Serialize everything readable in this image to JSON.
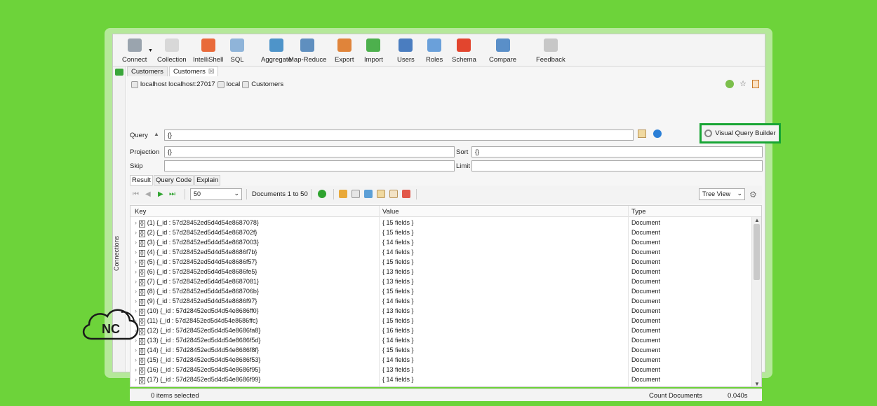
{
  "toolbar": [
    {
      "label": "Connect",
      "icon": "connect-icon",
      "color": "#9aa4ae"
    },
    {
      "label": "Collection",
      "icon": "collection-icon",
      "color": "#d8d8d8"
    },
    {
      "label": "IntelliShell",
      "icon": "intellishell-icon",
      "color": "#e96a3a"
    },
    {
      "label": "SQL",
      "icon": "sql-icon",
      "color": "#8fb4d9"
    },
    {
      "label": "Aggregate",
      "icon": "aggregate-icon",
      "color": "#4e94c9"
    },
    {
      "label": "Map-Reduce",
      "icon": "map-reduce-icon",
      "color": "#5f8fbf"
    },
    {
      "label": "Export",
      "icon": "export-icon",
      "color": "#e0843a"
    },
    {
      "label": "Import",
      "icon": "import-icon",
      "color": "#4db04d"
    },
    {
      "label": "Users",
      "icon": "users-icon",
      "color": "#4a7dc0"
    },
    {
      "label": "Roles",
      "icon": "roles-icon",
      "color": "#6aa0da"
    },
    {
      "label": "Schema",
      "icon": "schema-icon",
      "color": "#e2452e"
    },
    {
      "label": "Compare",
      "icon": "compare-icon",
      "color": "#5a8fc8"
    },
    {
      "label": "Feedback",
      "icon": "feedback-icon",
      "color": "#c7c7c7"
    }
  ],
  "sidebar": {
    "label": "Connections"
  },
  "tabs": [
    {
      "label": "Customers"
    },
    {
      "label": "Customers",
      "close": "☒"
    }
  ],
  "breadcrumb": {
    "server": "localhost localhost:27017",
    "db": "local",
    "collection": "Customers"
  },
  "query": {
    "query_label": "Query",
    "query_value": "{}",
    "projection_label": "Projection",
    "projection_value": "{}",
    "sort_label": "Sort",
    "sort_value": "{}",
    "skip_label": "Skip",
    "skip_value": "",
    "limit_label": "Limit",
    "limit_value": "",
    "vqb_label": "Visual Query Builder"
  },
  "result_tabs": [
    {
      "label": "Result"
    },
    {
      "label": "Query Code"
    },
    {
      "label": "Explain"
    }
  ],
  "pager": {
    "page_size": "50",
    "docs_label": "Documents 1 to 50",
    "view": "Tree View"
  },
  "grid": {
    "columns": [
      "Key",
      "Value",
      "Type"
    ],
    "rows": [
      {
        "key": "(1) {_id : 57d28452ed5d4d54e8687078}",
        "value": "{ 15 fields }",
        "type": "Document"
      },
      {
        "key": "(2) {_id : 57d28452ed5d4d54e868702f}",
        "value": "{ 15 fields }",
        "type": "Document"
      },
      {
        "key": "(3) {_id : 57d28452ed5d4d54e8687003}",
        "value": "{ 14 fields }",
        "type": "Document"
      },
      {
        "key": "(4) {_id : 57d28452ed5d4d54e8686f7b}",
        "value": "{ 14 fields }",
        "type": "Document"
      },
      {
        "key": "(5) {_id : 57d28452ed5d4d54e8686f57}",
        "value": "{ 15 fields }",
        "type": "Document"
      },
      {
        "key": "(6) {_id : 57d28452ed5d4d54e8686fe5}",
        "value": "{ 13 fields }",
        "type": "Document"
      },
      {
        "key": "(7) {_id : 57d28452ed5d4d54e8687081}",
        "value": "{ 13 fields }",
        "type": "Document"
      },
      {
        "key": "(8) {_id : 57d28452ed5d4d54e868706b}",
        "value": "{ 15 fields }",
        "type": "Document"
      },
      {
        "key": "(9) {_id : 57d28452ed5d4d54e8686f97}",
        "value": "{ 14 fields }",
        "type": "Document"
      },
      {
        "key": "(10) {_id : 57d28452ed5d4d54e8686ff0}",
        "value": "{ 13 fields }",
        "type": "Document"
      },
      {
        "key": "(11) {_id : 57d28452ed5d4d54e8686ffc}",
        "value": "{ 15 fields }",
        "type": "Document"
      },
      {
        "key": "(12) {_id : 57d28452ed5d4d54e8686fa8}",
        "value": "{ 16 fields }",
        "type": "Document"
      },
      {
        "key": "(13) {_id : 57d28452ed5d4d54e8686f5d}",
        "value": "{ 14 fields }",
        "type": "Document"
      },
      {
        "key": "(14) {_id : 57d28452ed5d4d54e8686f8f}",
        "value": "{ 15 fields }",
        "type": "Document"
      },
      {
        "key": "(15) {_id : 57d28452ed5d4d54e8686f53}",
        "value": "{ 14 fields }",
        "type": "Document"
      },
      {
        "key": "(16) {_id : 57d28452ed5d4d54e8686f95}",
        "value": "{ 13 fields }",
        "type": "Document"
      },
      {
        "key": "(17) {_id : 57d28452ed5d4d54e8686f99}",
        "value": "{ 14 fields }",
        "type": "Document"
      }
    ]
  },
  "status": {
    "selected": "0 items selected",
    "count": "Count Documents",
    "time": "0.040s"
  },
  "logo": {
    "text": "NC"
  },
  "colors": {
    "background": "#6dd33a",
    "highlight": "#18a534"
  }
}
